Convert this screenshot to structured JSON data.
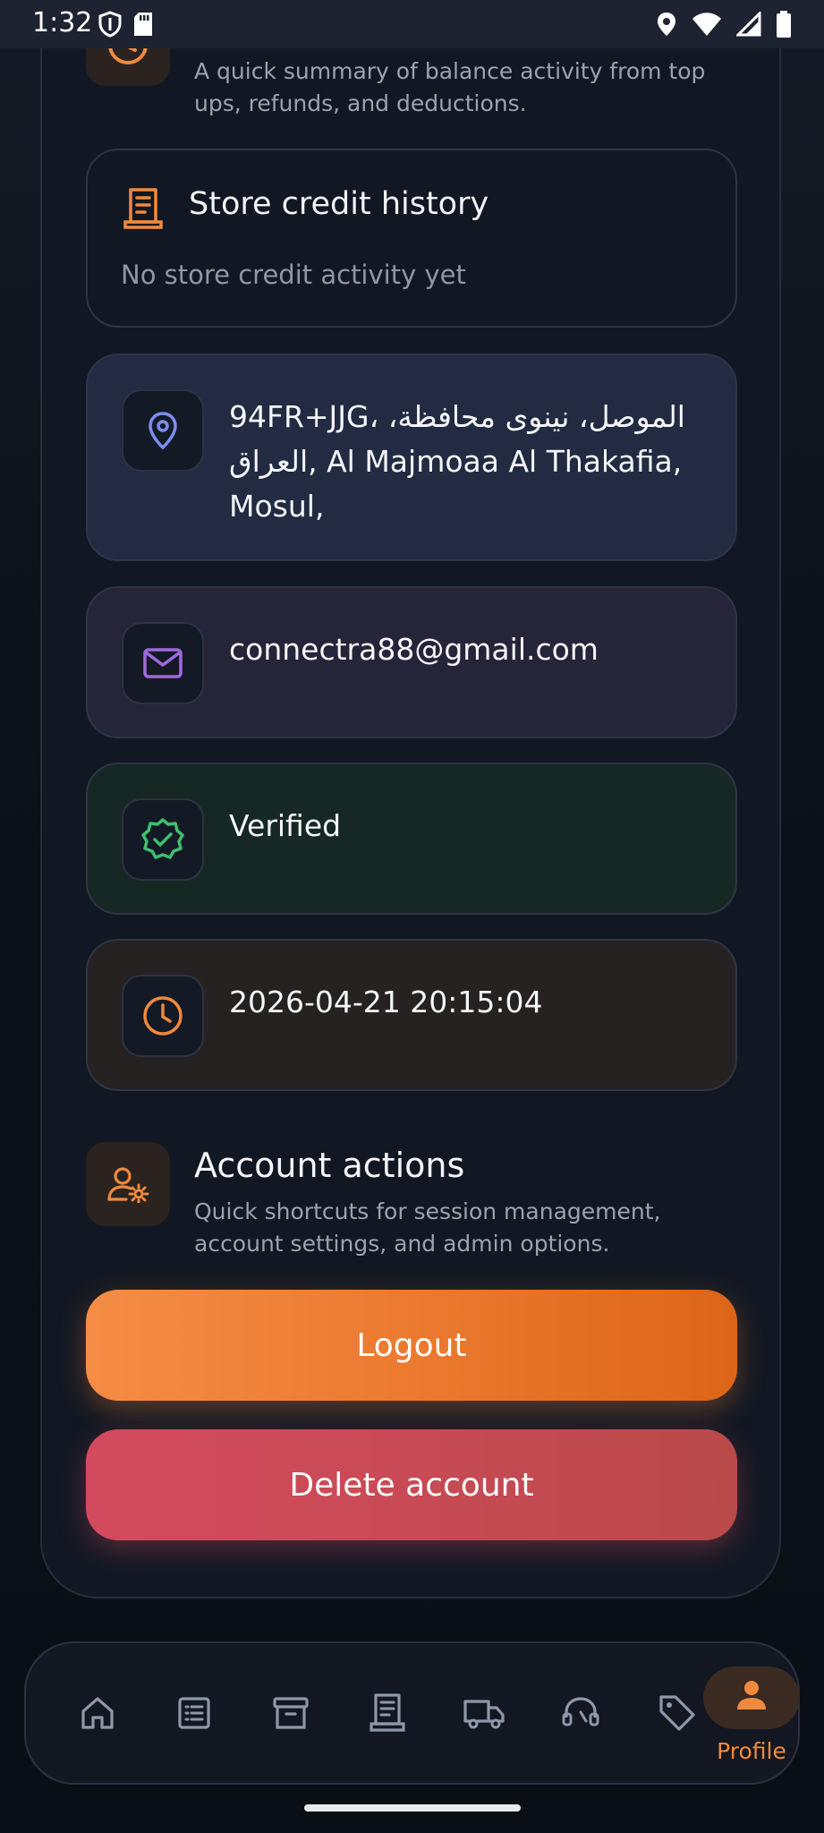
{
  "status_bar": {
    "time": "1:32",
    "left_icons": [
      "shield-icon",
      "sd-card-icon"
    ],
    "right_icons": [
      "location-icon",
      "wifi-icon",
      "signal-icon",
      "battery-icon"
    ]
  },
  "balance_summary": {
    "description": "A quick summary of balance activity from top ups, refunds, and deductions."
  },
  "store_credit": {
    "title": "Store credit history",
    "empty_text": "No store credit activity yet",
    "icon": "receipt-icon"
  },
  "profile_info": {
    "address": "94FR+JJG، الموصل، نينوى محافظة، العراق, Al Majmoaa Al Thakafia, Mosul,",
    "email": "connectra88@gmail.com",
    "verification": "Verified",
    "timestamp": "2026-04-21 20:15:04"
  },
  "account_actions": {
    "title": "Account actions",
    "description": "Quick shortcuts for session management, account settings, and admin options.",
    "logout_label": "Logout",
    "delete_label": "Delete account"
  },
  "bottom_nav": {
    "items": [
      "home-icon",
      "list-icon",
      "archive-icon",
      "receipt-icon",
      "truck-icon",
      "support-icon",
      "tag-icon",
      "profile-icon"
    ],
    "active_label": "Profile"
  },
  "colors": {
    "accent_orange": "#f08a3e",
    "address_blue": "#7c8cf0",
    "email_purple": "#a06ae0",
    "verified_green": "#3fbf6f",
    "delete_red": "#d34a5e"
  }
}
